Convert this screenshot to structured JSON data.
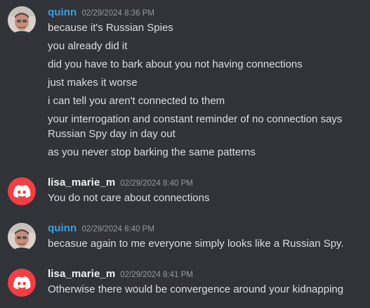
{
  "messages": [
    {
      "username": "quinn",
      "timestamp": "02/29/2024 8:36 PM",
      "avatar": "photo-avatar",
      "name_color": "#3aa0e6",
      "lines": [
        "because it's Russian Spies",
        "you already did it",
        "did you have to bark about you not having connections",
        "just makes it worse",
        "i can tell you aren't connected to them",
        "your interrogation and constant reminder of no connection says",
        "Russian Spy day in day out",
        "as you never stop barking the same patterns"
      ]
    },
    {
      "username": "lisa_marie_m",
      "timestamp": "02/29/2024 8:40 PM",
      "avatar": "discord-logo-avatar",
      "name_color": "#f2f3f5",
      "lines": [
        "You do not care about connections"
      ]
    },
    {
      "username": "quinn",
      "timestamp": "02/29/2024 8:40 PM",
      "avatar": "photo-avatar",
      "name_color": "#3aa0e6",
      "lines": [
        "becasue again to me everyone simply looks like a Russian Spy."
      ]
    },
    {
      "username": "lisa_marie_m",
      "timestamp": "02/29/2024 8:41 PM",
      "avatar": "discord-logo-avatar",
      "name_color": "#f2f3f5",
      "lines": [
        "Otherwise there would be convergence around your kidnapping"
      ]
    }
  ],
  "colors": {
    "background": "#313338",
    "text": "#dbdee1",
    "timestamp": "#949ba4",
    "discord_red": "#f23f43"
  }
}
